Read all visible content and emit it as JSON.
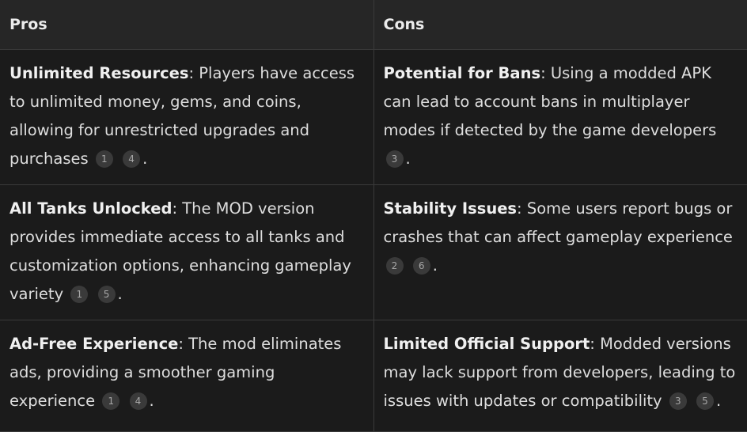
{
  "headers": {
    "pros": "Pros",
    "cons": "Cons"
  },
  "rows": [
    {
      "pro": {
        "lead": "Unlimited Resources",
        "text": ": Players have access to unlimited money, gems, and coins, allowing for unrestricted upgrades and purchases",
        "cites": [
          "1",
          "4"
        ],
        "end": "."
      },
      "con": {
        "lead": "Potential for Bans",
        "text": ": Using a modded APK can lead to account bans in multiplayer modes if detected by the game developers",
        "cites": [
          "3"
        ],
        "end": "."
      }
    },
    {
      "pro": {
        "lead": "All Tanks Unlocked",
        "text": ": The MOD version provides immediate access to all tanks and customization options, enhancing gameplay variety",
        "cites": [
          "1",
          "5"
        ],
        "end": "."
      },
      "con": {
        "lead": "Stability Issues",
        "text": ": Some users report bugs or crashes that can affect gameplay experience",
        "cites": [
          "2",
          "6"
        ],
        "end": "."
      }
    },
    {
      "pro": {
        "lead": "Ad-Free Experience",
        "text": ": The mod eliminates ads, providing a smoother gaming experience",
        "cites": [
          "1",
          "4"
        ],
        "end": "."
      },
      "con": {
        "lead": "Limited Official Support",
        "text": ": Modded versions may lack support from developers, leading to issues with updates or compatibility",
        "cites": [
          "3",
          "5"
        ],
        "end": "."
      }
    }
  ]
}
